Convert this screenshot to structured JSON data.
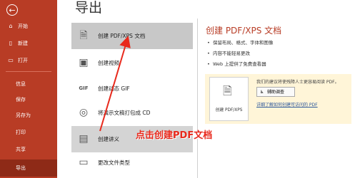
{
  "sidebar": {
    "back_icon": "back-arrow-icon",
    "items": [
      {
        "label": "开始",
        "icon": "home-icon"
      },
      {
        "label": "新建",
        "icon": "new-doc-icon"
      },
      {
        "label": "打开",
        "icon": "folder-open-icon"
      },
      {
        "label": "信息"
      },
      {
        "label": "保存"
      },
      {
        "label": "另存为"
      },
      {
        "label": "打印"
      },
      {
        "label": "共享"
      },
      {
        "label": "导出"
      }
    ],
    "selected": "导出"
  },
  "page_title": "导出",
  "export_options": [
    {
      "label": "创建 PDF/XPS 文档",
      "icon": "pdf-doc-icon"
    },
    {
      "label": "创建视频",
      "icon": "video-icon"
    },
    {
      "label": "创建动态 GIF",
      "icon": "gif-icon"
    },
    {
      "label": "将演示文稿打包成 CD",
      "icon": "cd-icon"
    },
    {
      "label": "创建讲义",
      "icon": "handout-icon"
    },
    {
      "label": "更改文件类型",
      "icon": "file-type-icon"
    }
  ],
  "detail": {
    "title": "创建 PDF/XPS 文档",
    "bullets": [
      "保留布局、格式、字体和图像",
      "内容不能轻易更改",
      "Web 上提供了免费查看器"
    ],
    "card_label": "创建 PDF/XPS",
    "notice": "我们的建议将使残障人士更容易阅读 PDF。",
    "assist_button": "辅助调查",
    "link": "详细了解如何创建可访问的 PDF"
  },
  "annotation": "点击创建PDF文档",
  "colors": {
    "sidebar": "#b83c25",
    "sidebar_selected": "#8e2a17",
    "accent": "#b83c25",
    "annotation": "#e8291c"
  }
}
